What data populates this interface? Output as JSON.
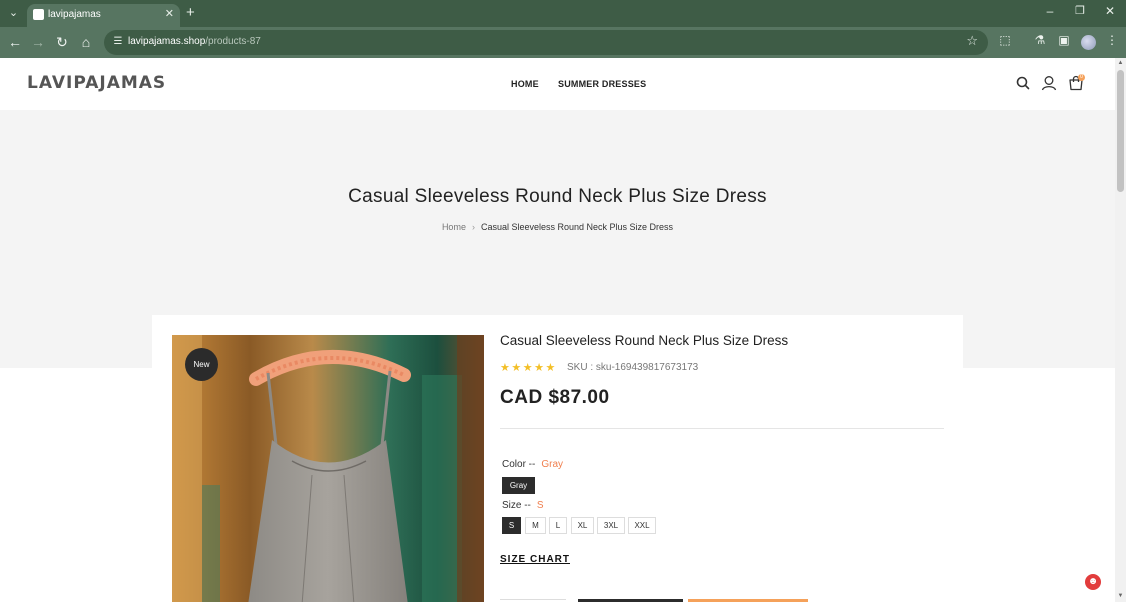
{
  "browser": {
    "tab_title": "lavipajamas",
    "url_host": "lavipajamas.shop",
    "url_path": "/products-87"
  },
  "site": {
    "logo": "LAVIPAJAMAS",
    "nav": [
      "HOME",
      "SUMMER DRESSES"
    ],
    "cart_count": "0"
  },
  "hero": {
    "title": "Casual Sleeveless Round Neck Plus Size Dress",
    "breadcrumb": {
      "home": "Home",
      "current": "Casual Sleeveless Round Neck Plus Size Dress"
    }
  },
  "product": {
    "badge": "New",
    "title": "Casual Sleeveless Round Neck Plus Size Dress",
    "rating": 5,
    "sku_label": "SKU : sku-169439817673173",
    "price": "CAD $87.00",
    "color": {
      "label": "Color --",
      "selected": "Gray",
      "options": [
        "Gray"
      ]
    },
    "size": {
      "label": "Size --",
      "selected": "S",
      "options": [
        "S",
        "M",
        "L",
        "XL",
        "3XL",
        "XXL"
      ]
    },
    "size_chart": "SIZE CHART"
  },
  "colors": {
    "chrome_dark": "#3e5c46",
    "chrome_light": "#577561",
    "accent": "#f07f4e",
    "star": "#f3bf27",
    "hero_bg": "#f4f4f4"
  }
}
